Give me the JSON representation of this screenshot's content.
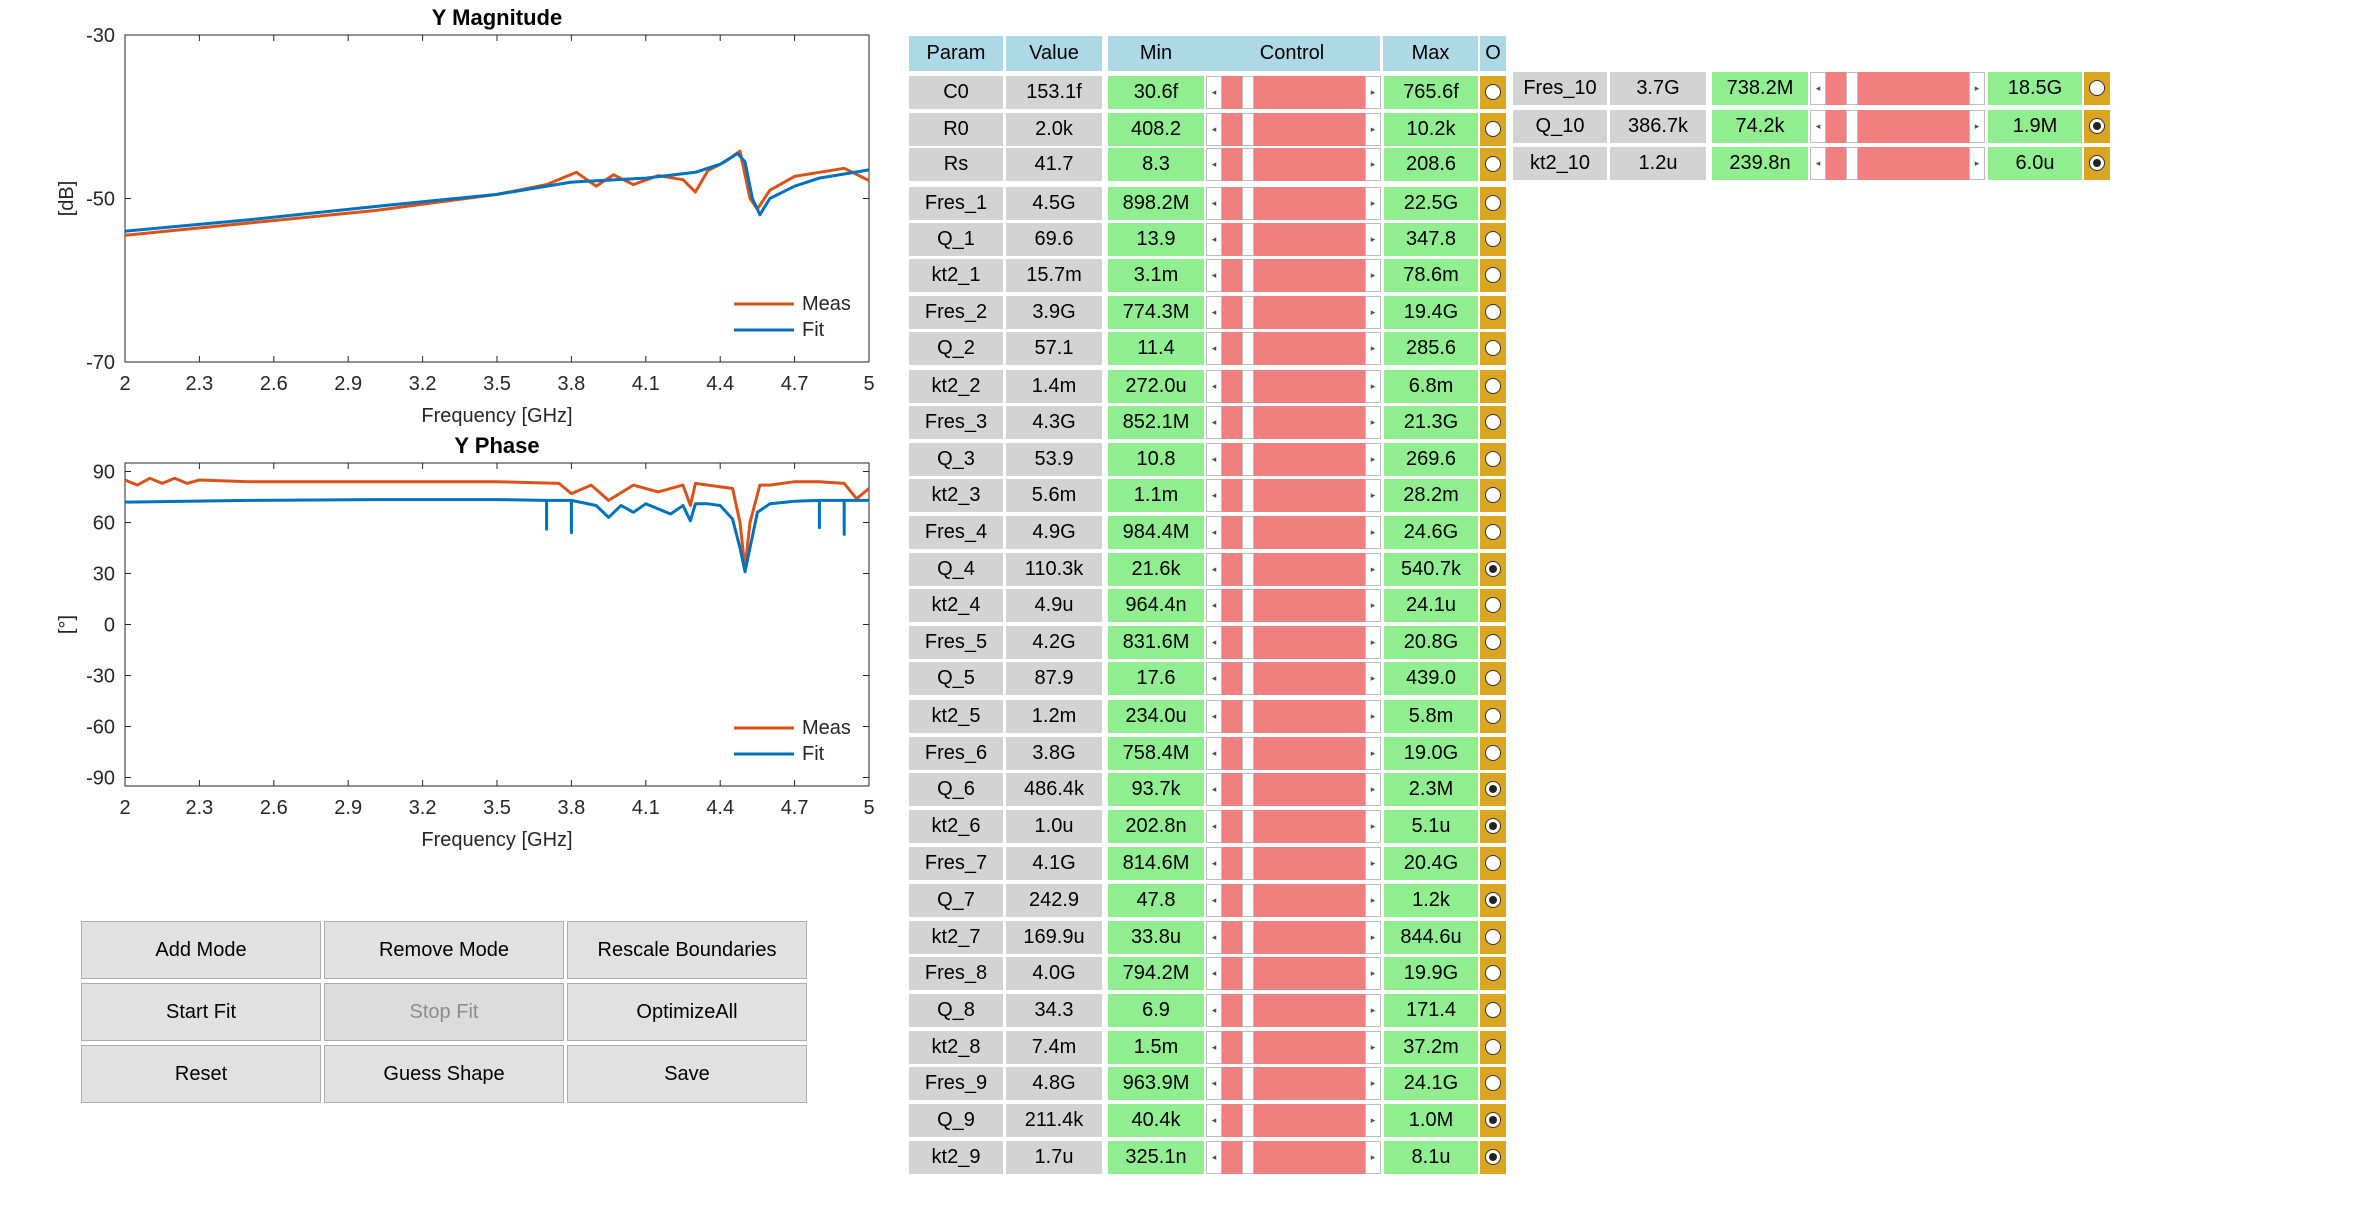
{
  "charts": {
    "magnitude": {
      "title": "Y Magnitude",
      "xlabel": "Frequency [GHz]",
      "ylabel": "[dB]",
      "xticks": [
        "2",
        "2.3",
        "2.6",
        "2.9",
        "3.2",
        "3.5",
        "3.8",
        "4.1",
        "4.4",
        "4.7",
        "5"
      ],
      "yticks": [
        "-30",
        "-50",
        "-70"
      ],
      "legend": [
        "Meas",
        "Fit"
      ]
    },
    "phase": {
      "title": "Y Phase",
      "xlabel": "Frequency [GHz]",
      "ylabel": "[°]",
      "xticks": [
        "2",
        "2.3",
        "2.6",
        "2.9",
        "3.2",
        "3.5",
        "3.8",
        "4.1",
        "4.4",
        "4.7",
        "5"
      ],
      "yticks": [
        "90",
        "60",
        "30",
        "0",
        "-30",
        "-60",
        "-90"
      ],
      "legend": [
        "Meas",
        "Fit"
      ]
    }
  },
  "chart_data": [
    {
      "type": "line",
      "title": "Y Magnitude",
      "xlabel": "Frequency [GHz]",
      "ylabel": "[dB]",
      "xlim": [
        2,
        5
      ],
      "ylim": [
        -70,
        -30
      ],
      "grid": false,
      "legend_position": "bottom-right",
      "series": [
        {
          "name": "Meas",
          "color": "#d95319",
          "x": [
            2.0,
            2.5,
            3.0,
            3.5,
            3.7,
            3.82,
            3.9,
            3.97,
            4.05,
            4.15,
            4.25,
            4.3,
            4.35,
            4.42,
            4.48,
            4.52,
            4.55,
            4.6,
            4.7,
            4.8,
            4.9,
            5.0
          ],
          "y": [
            -54.5,
            -53.0,
            -51.5,
            -49.5,
            -48.3,
            -46.8,
            -48.5,
            -47.1,
            -48.3,
            -47.2,
            -47.7,
            -49.2,
            -46.6,
            -45.5,
            -44.2,
            -50.0,
            -51.3,
            -49.0,
            -47.3,
            -46.8,
            -46.3,
            -47.8
          ]
        },
        {
          "name": "Fit",
          "color": "#0072bd",
          "x": [
            2.0,
            2.5,
            3.0,
            3.5,
            3.8,
            4.1,
            4.3,
            4.4,
            4.47,
            4.5,
            4.53,
            4.56,
            4.6,
            4.7,
            4.8,
            4.9,
            5.0
          ],
          "y": [
            -54.0,
            -52.6,
            -51.0,
            -49.5,
            -48.0,
            -47.5,
            -46.8,
            -45.8,
            -44.5,
            -45.5,
            -50.0,
            -52.0,
            -50.0,
            -48.5,
            -47.5,
            -47.0,
            -46.5
          ]
        }
      ]
    },
    {
      "type": "line",
      "title": "Y Phase",
      "xlabel": "Frequency [GHz]",
      "ylabel": "[°]",
      "xlim": [
        2,
        5
      ],
      "ylim": [
        -95,
        95
      ],
      "grid": false,
      "legend_position": "bottom-right",
      "series": [
        {
          "name": "Meas",
          "color": "#d95319",
          "x": [
            2.0,
            2.05,
            2.1,
            2.15,
            2.2,
            2.25,
            2.3,
            2.5,
            3.0,
            3.5,
            3.75,
            3.8,
            3.88,
            3.95,
            4.05,
            4.15,
            4.25,
            4.28,
            4.3,
            4.35,
            4.45,
            4.48,
            4.5,
            4.52,
            4.56,
            4.6,
            4.7,
            4.8,
            4.9,
            4.95,
            5.0
          ],
          "y": [
            85,
            82,
            86,
            83,
            86,
            83,
            85,
            84,
            84,
            84,
            83,
            77,
            82,
            73,
            82,
            78,
            82,
            70,
            83,
            82,
            80,
            60,
            33,
            60,
            82,
            82,
            84,
            84,
            83,
            74,
            80
          ]
        },
        {
          "name": "Fit",
          "color": "#0072bd",
          "x": [
            2.0,
            2.5,
            3.0,
            3.5,
            3.7,
            3.7,
            3.7,
            3.8,
            3.8,
            3.8,
            3.9,
            3.95,
            4.0,
            4.05,
            4.1,
            4.2,
            4.25,
            4.28,
            4.3,
            4.35,
            4.4,
            4.45,
            4.48,
            4.5,
            4.52,
            4.55,
            4.6,
            4.7,
            4.8,
            4.8,
            4.8,
            4.9,
            4.9,
            4.9,
            5.0
          ],
          "y": [
            72,
            73,
            73.5,
            73.5,
            73,
            56,
            73,
            73,
            54,
            73,
            70,
            63,
            70,
            66,
            71,
            65,
            70,
            61,
            71,
            71,
            70,
            62,
            45,
            31,
            45,
            66,
            71,
            72.5,
            73,
            57,
            73,
            73,
            53,
            73,
            73
          ]
        }
      ]
    }
  ],
  "buttons": {
    "add_mode": "Add Mode",
    "remove_mode": "Remove Mode",
    "rescale": "Rescale Boundaries",
    "start_fit": "Start Fit",
    "stop_fit": "Stop Fit",
    "optimize_all": "OptimizeAll",
    "reset": "Reset",
    "guess_shape": "Guess Shape",
    "save": "Save"
  },
  "table": {
    "headers": {
      "param": "Param",
      "value": "Value",
      "min": "Min",
      "control": "Control",
      "max": "Max",
      "o": "O"
    },
    "rows": [
      {
        "param": "C0",
        "value": "153.1f",
        "min": "30.6f",
        "max": "765.6f",
        "opt": false,
        "slider": 0.15
      },
      {
        "param": "R0",
        "value": "2.0k",
        "min": "408.2",
        "max": "10.2k",
        "opt": false,
        "slider": 0.15
      },
      {
        "param": "Rs",
        "value": "41.7",
        "min": "8.3",
        "max": "208.6",
        "opt": false,
        "slider": 0.15
      },
      {
        "param": "Fres_1",
        "value": "4.5G",
        "min": "898.2M",
        "max": "22.5G",
        "opt": false,
        "slider": 0.15
      },
      {
        "param": "Q_1",
        "value": "69.6",
        "min": "13.9",
        "max": "347.8",
        "opt": false,
        "slider": 0.15
      },
      {
        "param": "kt2_1",
        "value": "15.7m",
        "min": "3.1m",
        "max": "78.6m",
        "opt": false,
        "slider": 0.15
      },
      {
        "param": "Fres_2",
        "value": "3.9G",
        "min": "774.3M",
        "max": "19.4G",
        "opt": false,
        "slider": 0.15
      },
      {
        "param": "Q_2",
        "value": "57.1",
        "min": "11.4",
        "max": "285.6",
        "opt": false,
        "slider": 0.15
      },
      {
        "param": "kt2_2",
        "value": "1.4m",
        "min": "272.0u",
        "max": "6.8m",
        "opt": false,
        "slider": 0.15
      },
      {
        "param": "Fres_3",
        "value": "4.3G",
        "min": "852.1M",
        "max": "21.3G",
        "opt": false,
        "slider": 0.15
      },
      {
        "param": "Q_3",
        "value": "53.9",
        "min": "10.8",
        "max": "269.6",
        "opt": false,
        "slider": 0.15
      },
      {
        "param": "kt2_3",
        "value": "5.6m",
        "min": "1.1m",
        "max": "28.2m",
        "opt": false,
        "slider": 0.15
      },
      {
        "param": "Fres_4",
        "value": "4.9G",
        "min": "984.4M",
        "max": "24.6G",
        "opt": false,
        "slider": 0.15
      },
      {
        "param": "Q_4",
        "value": "110.3k",
        "min": "21.6k",
        "max": "540.7k",
        "opt": true,
        "slider": 0.15
      },
      {
        "param": "kt2_4",
        "value": "4.9u",
        "min": "964.4n",
        "max": "24.1u",
        "opt": false,
        "slider": 0.15
      },
      {
        "param": "Fres_5",
        "value": "4.2G",
        "min": "831.6M",
        "max": "20.8G",
        "opt": false,
        "slider": 0.15
      },
      {
        "param": "Q_5",
        "value": "87.9",
        "min": "17.6",
        "max": "439.0",
        "opt": false,
        "slider": 0.15
      },
      {
        "param": "kt2_5",
        "value": "1.2m",
        "min": "234.0u",
        "max": "5.8m",
        "opt": false,
        "slider": 0.15
      },
      {
        "param": "Fres_6",
        "value": "3.8G",
        "min": "758.4M",
        "max": "19.0G",
        "opt": false,
        "slider": 0.15
      },
      {
        "param": "Q_6",
        "value": "486.4k",
        "min": "93.7k",
        "max": "2.3M",
        "opt": true,
        "slider": 0.15
      },
      {
        "param": "kt2_6",
        "value": "1.0u",
        "min": "202.8n",
        "max": "5.1u",
        "opt": true,
        "slider": 0.15
      },
      {
        "param": "Fres_7",
        "value": "4.1G",
        "min": "814.6M",
        "max": "20.4G",
        "opt": false,
        "slider": 0.15
      },
      {
        "param": "Q_7",
        "value": "242.9",
        "min": "47.8",
        "max": "1.2k",
        "opt": true,
        "slider": 0.15
      },
      {
        "param": "kt2_7",
        "value": "169.9u",
        "min": "33.8u",
        "max": "844.6u",
        "opt": false,
        "slider": 0.15
      },
      {
        "param": "Fres_8",
        "value": "4.0G",
        "min": "794.2M",
        "max": "19.9G",
        "opt": false,
        "slider": 0.15
      },
      {
        "param": "Q_8",
        "value": "34.3",
        "min": "6.9",
        "max": "171.4",
        "opt": false,
        "slider": 0.15
      },
      {
        "param": "kt2_8",
        "value": "7.4m",
        "min": "1.5m",
        "max": "37.2m",
        "opt": false,
        "slider": 0.15
      },
      {
        "param": "Fres_9",
        "value": "4.8G",
        "min": "963.9M",
        "max": "24.1G",
        "opt": false,
        "slider": 0.15
      },
      {
        "param": "Q_9",
        "value": "211.4k",
        "min": "40.4k",
        "max": "1.0M",
        "opt": true,
        "slider": 0.15
      },
      {
        "param": "kt2_9",
        "value": "1.7u",
        "min": "325.1n",
        "max": "8.1u",
        "opt": true,
        "slider": 0.15
      }
    ],
    "extra_rows": [
      {
        "param": "Fres_10",
        "value": "3.7G",
        "min": "738.2M",
        "max": "18.5G",
        "opt": false,
        "slider": 0.15
      },
      {
        "param": "Q_10",
        "value": "386.7k",
        "min": "74.2k",
        "max": "1.9M",
        "opt": true,
        "slider": 0.15
      },
      {
        "param": "kt2_10",
        "value": "1.2u",
        "min": "239.8n",
        "max": "6.0u",
        "opt": true,
        "slider": 0.15
      }
    ]
  }
}
